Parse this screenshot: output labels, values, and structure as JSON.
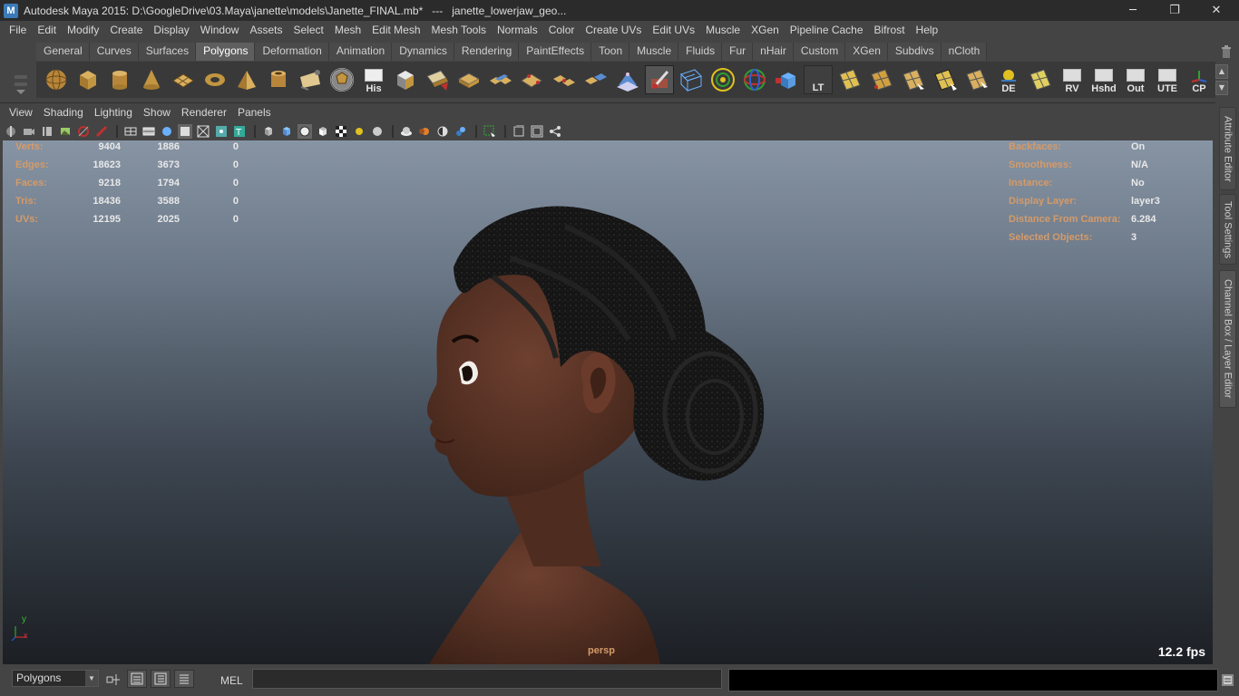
{
  "window": {
    "title": "Autodesk Maya 2015: D:\\GoogleDrive\\03.Maya\\janette\\models\\Janette_FINAL.mb*   ---   janette_lowerjaw_geo...",
    "app_icon_letter": "M",
    "minimize": "─",
    "restore": "❐",
    "close": "✕"
  },
  "menubar": [
    "File",
    "Edit",
    "Modify",
    "Create",
    "Display",
    "Window",
    "Assets",
    "Select",
    "Mesh",
    "Edit Mesh",
    "Mesh Tools",
    "Normals",
    "Color",
    "Create UVs",
    "Edit UVs",
    "Muscle",
    "XGen",
    "Pipeline Cache",
    "Bifrost",
    "Help"
  ],
  "shelf": {
    "tabs": [
      "General",
      "Curves",
      "Surfaces",
      "Polygons",
      "Deformation",
      "Animation",
      "Dynamics",
      "Rendering",
      "PaintEffects",
      "Toon",
      "Muscle",
      "Fluids",
      "Fur",
      "nHair",
      "Custom",
      "XGen",
      "Subdivs",
      "nCloth"
    ],
    "active_tab": "Polygons",
    "text_buttons": {
      "his": "His",
      "lt": "LT",
      "de": "DE",
      "rv": "RV",
      "hshd": "Hshd",
      "out": "Out",
      "ute": "UTE",
      "cp": "CP"
    }
  },
  "panel": {
    "menus": [
      "View",
      "Shading",
      "Lighting",
      "Show",
      "Renderer",
      "Panels"
    ]
  },
  "hud": {
    "stats": [
      {
        "label": "Verts:",
        "total": "9404",
        "selected": "1886",
        "component": "0"
      },
      {
        "label": "Edges:",
        "total": "18623",
        "selected": "3673",
        "component": "0"
      },
      {
        "label": "Faces:",
        "total": "9218",
        "selected": "1794",
        "component": "0"
      },
      {
        "label": "Tris:",
        "total": "18436",
        "selected": "3588",
        "component": "0"
      },
      {
        "label": "UVs:",
        "total": "12195",
        "selected": "2025",
        "component": "0"
      }
    ],
    "info": [
      {
        "label": "Backfaces:",
        "value": "On"
      },
      {
        "label": "Smoothness:",
        "value": "N/A"
      },
      {
        "label": "Instance:",
        "value": "No"
      },
      {
        "label": "Display Layer:",
        "value": "layer3"
      },
      {
        "label": "Distance From Camera:",
        "value": "6.284"
      },
      {
        "label": "Selected Objects:",
        "value": "3"
      }
    ],
    "camera": "persp",
    "fps": "12.2 fps",
    "axis_y": "y",
    "axis_x": "x"
  },
  "side_tabs": [
    "Attribute Editor",
    "Tool Settings",
    "Channel Box / Layer Editor"
  ],
  "cmdline": {
    "mode": "Polygons",
    "lang": "MEL",
    "input_value": ""
  },
  "colors": {
    "skin": "#5a3426",
    "hair": "#141414",
    "hud_label": "#d49b6a",
    "viewport_top": "#8794a4",
    "viewport_bottom": "#1c1f24"
  }
}
